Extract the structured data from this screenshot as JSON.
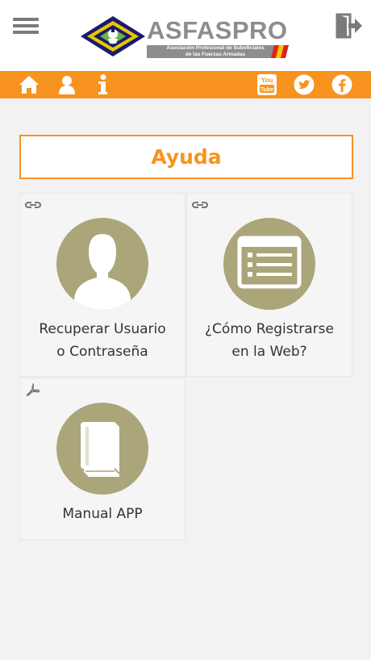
{
  "header": {
    "brand_name": "ASFASPRO",
    "brand_subtitle_line1": "Asociación Profesional de Suboficiales",
    "brand_subtitle_line2": "de las Fuerzas Armadas",
    "menu_icon": "hamburger-menu-icon",
    "logout_icon": "logout-icon"
  },
  "toolbar": {
    "background": "#f7931e",
    "left_icons": [
      "home-icon",
      "user-icon",
      "info-icon"
    ],
    "right_icons": [
      "youtube-icon",
      "twitter-icon",
      "facebook-icon"
    ],
    "youtube_text_top": "You",
    "youtube_text_bottom": "Tube"
  },
  "main": {
    "title": "Ayuda",
    "accent_color": "#f7931e",
    "circle_color": "#aaa67a",
    "tiles": [
      {
        "line1": "Recuperar Usuario",
        "line2": "o Contraseña",
        "badge": "link-icon",
        "icon": "user-silhouette-icon"
      },
      {
        "line1": "¿Cómo Registrarse",
        "line2": "en la Web?",
        "badge": "link-icon",
        "icon": "form-icon"
      },
      {
        "line1": "Manual APP",
        "line2": "",
        "badge": "pdf-icon",
        "icon": "book-icon"
      }
    ]
  }
}
